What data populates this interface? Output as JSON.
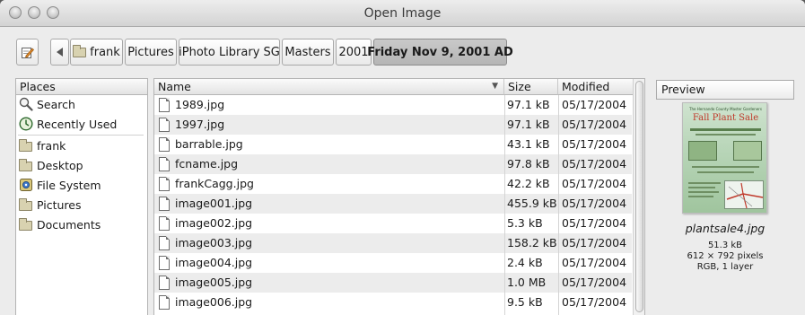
{
  "window": {
    "title": "Open Image"
  },
  "pathbar": {
    "edit_icon": "edit-location-icon",
    "back_icon": "left-arrow-icon",
    "crumbs": [
      "frank",
      "Pictures",
      "iPhoto Library SG",
      "Masters",
      "2001",
      "Friday Nov 9, 2001 AD"
    ]
  },
  "places": {
    "header": "Places",
    "items": [
      {
        "label": "Search",
        "icon": "magnifier-icon"
      },
      {
        "label": "Recently Used",
        "icon": "clock-icon"
      },
      {
        "label": "frank",
        "icon": "folder-icon"
      },
      {
        "label": "Desktop",
        "icon": "folder-icon"
      },
      {
        "label": "File System",
        "icon": "drive-icon"
      },
      {
        "label": "Pictures",
        "icon": "folder-icon"
      },
      {
        "label": "Documents",
        "icon": "folder-icon"
      }
    ]
  },
  "files": {
    "columns": {
      "name": "Name",
      "size": "Size",
      "modified": "Modified"
    },
    "sort_indicator": "▼",
    "rows": [
      {
        "name": "1989.jpg",
        "size": "97.1 kB",
        "modified": "05/17/2004"
      },
      {
        "name": "1997.jpg",
        "size": "97.1 kB",
        "modified": "05/17/2004"
      },
      {
        "name": "barrable.jpg",
        "size": "43.1 kB",
        "modified": "05/17/2004"
      },
      {
        "name": "fcname.jpg",
        "size": "97.8 kB",
        "modified": "05/17/2004"
      },
      {
        "name": "frankCagg.jpg",
        "size": "42.2 kB",
        "modified": "05/17/2004"
      },
      {
        "name": "image001.jpg",
        "size": "455.9 kB",
        "modified": "05/17/2004"
      },
      {
        "name": "image002.jpg",
        "size": "5.3 kB",
        "modified": "05/17/2004"
      },
      {
        "name": "image003.jpg",
        "size": "158.2 kB",
        "modified": "05/17/2004"
      },
      {
        "name": "image004.jpg",
        "size": "2.4 kB",
        "modified": "05/17/2004"
      },
      {
        "name": "image005.jpg",
        "size": "1.0 MB",
        "modified": "05/17/2004"
      },
      {
        "name": "image006.jpg",
        "size": "9.5 kB",
        "modified": "05/17/2004"
      }
    ]
  },
  "preview": {
    "label": "Preview",
    "thumb": {
      "headline": "Fall Plant Sale",
      "title_band": "The Hernando County Master Gardeners"
    },
    "filename": "plantsale4.jpg",
    "size": "51.3 kB",
    "dimensions": "612 × 792 pixels",
    "mode": "RGB, 1 layer"
  }
}
